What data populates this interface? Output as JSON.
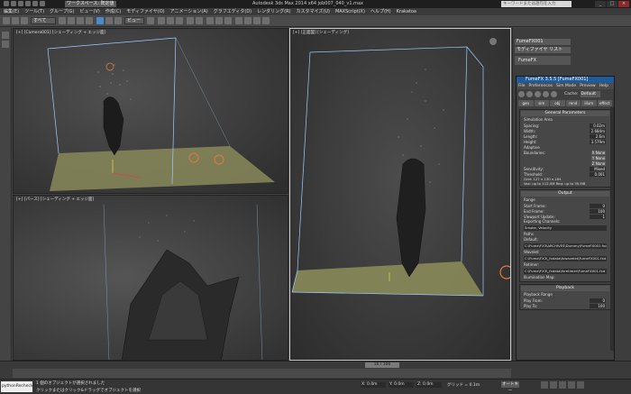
{
  "window": {
    "title": "Autodesk 3ds Max  2014 x64    job007_040_v1.max",
    "workspace": "ワークスペース: 既定値",
    "search_placeholder": "キーワードまたは語句を入力"
  },
  "menus": [
    "編集(E)",
    "ツール(T)",
    "グループ(G)",
    "ビュー(V)",
    "作成(C)",
    "モディファイヤ(O)",
    "アニメーション(A)",
    "グラフエディタ(D)",
    "レンダリング(R)",
    "カスタマイズ(U)",
    "MAXScript(X)",
    "ヘルプ(H)",
    "Krakatoa"
  ],
  "toolbar": {
    "selection_filter": "すべて",
    "view_dropdown": "ビュー"
  },
  "viewports": {
    "camera_label": "[+] [Camera001] [シェーディング + エッジ面]",
    "persp_label": "[+] [パース] [シェーディング + エッジ面]",
    "main_label": "[+] [正面図] [シェーディング]"
  },
  "command_panel": {
    "object_name": "FumeFX001",
    "modifier_list": "モディファイヤ リスト",
    "stack_item": "FumeFX"
  },
  "fumefx": {
    "title": "FumeFX 3.5.5 [FumeFX001]",
    "menu": [
      "File",
      "Preferences",
      "Sim Mode",
      "Preview",
      "Help"
    ],
    "cache_label": "Cache:",
    "cache_value": "Default",
    "tabs": [
      "gen",
      "sim",
      "obj",
      "rend",
      "illum",
      "effect"
    ],
    "general_header": "General Parameters",
    "sim_area": "Simulation Area",
    "spacing": {
      "label": "Spacing:",
      "value": "0.02m"
    },
    "width": {
      "label": "Width:",
      "value": "2.684m"
    },
    "length": {
      "label": "Length:",
      "value": "2.6m"
    },
    "height": {
      "label": "Height:",
      "value": "3.579m"
    },
    "adaptive": {
      "label": "Adaptive"
    },
    "boundaries": {
      "label": "Boundaries:",
      "x": "X None",
      "y": "Y None",
      "z": "Z None"
    },
    "sensitivity": {
      "label": "Sensitivity:",
      "value": "Mixed"
    },
    "threshold": {
      "label": "Threshold:",
      "value": "0.001"
    },
    "grid_info": "Grid: 127 x 130 x 184",
    "vox_info": "Vox: up to 112.0M    Req: up to 39 MB",
    "output_header": "Output",
    "range": "Range",
    "start_frame": {
      "label": "Start Frame:",
      "value": "0"
    },
    "end_frame": {
      "label": "End Frame:",
      "value": "100"
    },
    "viewport_update": {
      "label": "Viewport Update:",
      "value": "1"
    },
    "exporting": "Exporting Channels:",
    "export_value": "Smoke, Velocity",
    "paths": "Paths",
    "default_label": "Default:",
    "default_path": "C:\\Fume\\FX3\\ARCHIVES\\Dummy\\FumeFX001.fxd",
    "wavelet_label": "Wavelet:",
    "wavelet_path": "C:\\Fume\\FX3\\_fxdata\\fxwavelet\\FumeFX001.fxd",
    "retimer_label": "Retimer:",
    "retimer_path": "C:\\Fume\\FX3\\_fxdata\\fxretimer\\FumeFX001.fxd",
    "illum_label": "Illumination Map:",
    "playback_header": "Playback",
    "playback_range": "Playback Range",
    "play_from": {
      "label": "Play From:",
      "value": "0"
    },
    "play_to": {
      "label": "Play To:",
      "value": "100"
    }
  },
  "timeline": {
    "slider": "16 / 100"
  },
  "status": {
    "script_listener": "pythonRecheck.e",
    "message1": "1 個のオブジェクトが選択されました",
    "message2": "クリックまたはクリック&ドラッグでオブジェクトを選択",
    "x": "X: 0.0m",
    "y": "Y: 0.0m",
    "z": "Z: 0.0m",
    "grid": "グリッド = 0.1m",
    "autokey": "オートキー"
  },
  "colors": {
    "fume_title": "#1f5a9a",
    "selection_box": "#9ecbff",
    "ground": "#8a8a5a"
  }
}
